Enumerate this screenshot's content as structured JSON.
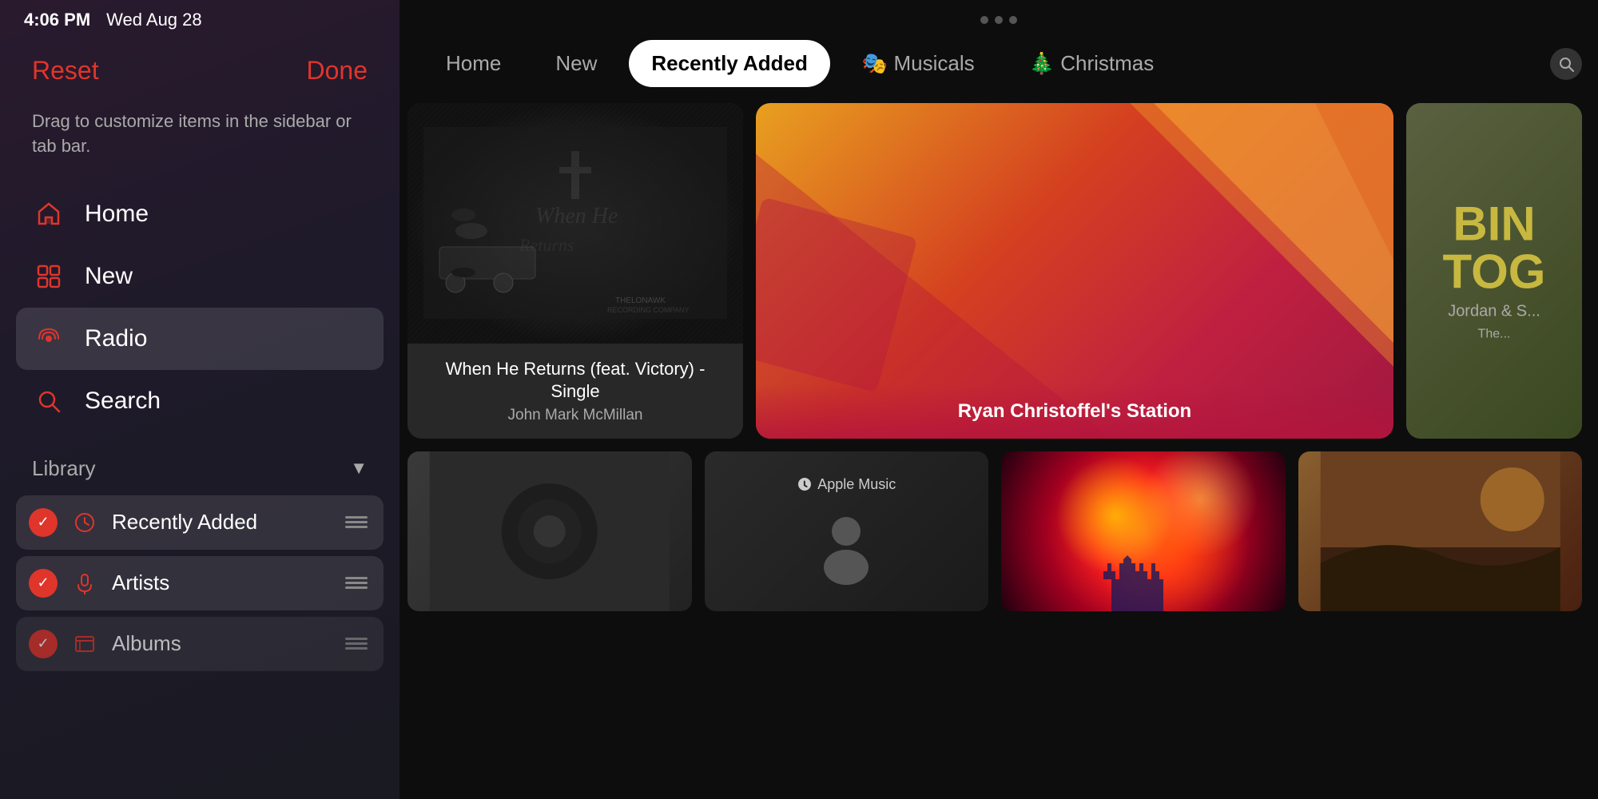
{
  "statusBar": {
    "time": "4:06 PM",
    "date": "Wed Aug 28"
  },
  "sidebar": {
    "resetLabel": "Reset",
    "doneLabel": "Done",
    "description": "Drag to customize items in the sidebar or tab bar.",
    "navItems": [
      {
        "id": "home",
        "label": "Home",
        "icon": "🏠"
      },
      {
        "id": "new",
        "label": "New",
        "icon": "⊞"
      },
      {
        "id": "radio",
        "label": "Radio",
        "icon": "📻",
        "active": true
      },
      {
        "id": "search",
        "label": "Search",
        "icon": "🔍"
      }
    ],
    "libraryTitle": "Library",
    "libraryItems": [
      {
        "id": "recently-added",
        "label": "Recently Added"
      },
      {
        "id": "artists",
        "label": "Artists"
      },
      {
        "id": "albums",
        "label": "Albums"
      }
    ]
  },
  "tabs": [
    {
      "id": "home",
      "label": "Home",
      "active": false
    },
    {
      "id": "new",
      "label": "New",
      "active": false
    },
    {
      "id": "recently-added",
      "label": "Recently Added",
      "active": true
    },
    {
      "id": "musicals",
      "label": "🎭 Musicals",
      "active": false
    },
    {
      "id": "christmas",
      "label": "🎄 Christmas",
      "active": false
    }
  ],
  "cards": {
    "top": [
      {
        "id": "when-he-returns",
        "title": "When He Returns (feat. Victory) - Single",
        "subtitle": "John Mark McMillan",
        "type": "large"
      },
      {
        "id": "ryan-christoffel",
        "title": "Ryan Christoffel's Station",
        "type": "medium"
      },
      {
        "id": "bind-us-together",
        "titleBig": "BIND",
        "titleBig2": "TOG",
        "subtitle": "Jordan & S...",
        "note": "The...",
        "type": "third"
      }
    ],
    "bottom": [
      {
        "id": "bottom-1",
        "type": "small-1"
      },
      {
        "id": "bottom-2",
        "appleMusicLabel": "Apple Music",
        "type": "small-2"
      },
      {
        "id": "bottom-3",
        "type": "small-3"
      },
      {
        "id": "bottom-4",
        "type": "small-4"
      }
    ]
  },
  "dots": [
    "dot1",
    "dot2",
    "dot3"
  ]
}
